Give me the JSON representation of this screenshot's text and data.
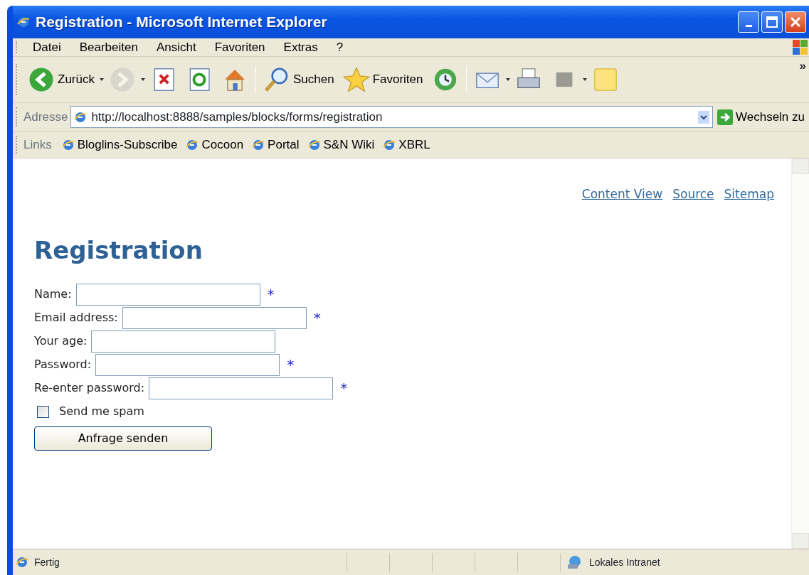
{
  "window": {
    "title": "Registration - Microsoft Internet Explorer"
  },
  "menu": [
    "Datei",
    "Bearbeiten",
    "Ansicht",
    "Favoriten",
    "Extras",
    "?"
  ],
  "toolbar": [
    {
      "kind": "back",
      "label": "Zurück",
      "disabled": false
    },
    {
      "kind": "forward",
      "disabled": true
    },
    {
      "kind": "stop"
    },
    {
      "kind": "refresh"
    },
    {
      "kind": "home"
    },
    {
      "kind": "sep"
    },
    {
      "kind": "search",
      "label": "Suchen"
    },
    {
      "kind": "favorites",
      "label": "Favoriten"
    },
    {
      "kind": "history"
    },
    {
      "kind": "sep"
    },
    {
      "kind": "mail"
    },
    {
      "kind": "print"
    },
    {
      "kind": "edit"
    },
    {
      "kind": "note"
    }
  ],
  "toolbar_more": "»",
  "address": {
    "label": "Adresse",
    "value": "http://localhost:8888/samples/blocks/forms/registration",
    "go": "Wechseln zu"
  },
  "links": {
    "label": "Links",
    "items": [
      "Bloglins-Subscribe",
      "Cocoon",
      "Portal",
      "S&N Wiki",
      "XBRL"
    ]
  },
  "page": {
    "nav": [
      "Content View",
      "Source",
      "Sitemap"
    ],
    "heading": "Registration",
    "fields": [
      {
        "label": "Name:",
        "required_mark": "*"
      },
      {
        "label": "Email address:",
        "required_mark": "*"
      },
      {
        "label": "Your age:"
      },
      {
        "label": "Password:",
        "required_mark": "*"
      },
      {
        "label": "Re-enter password:",
        "required_mark": "*"
      }
    ],
    "checkbox": {
      "label": "Send me spam",
      "checked": false
    },
    "submit": "Anfrage senden"
  },
  "status_bar": {
    "text": "Fertig",
    "zone": "Lokales Intranet"
  }
}
